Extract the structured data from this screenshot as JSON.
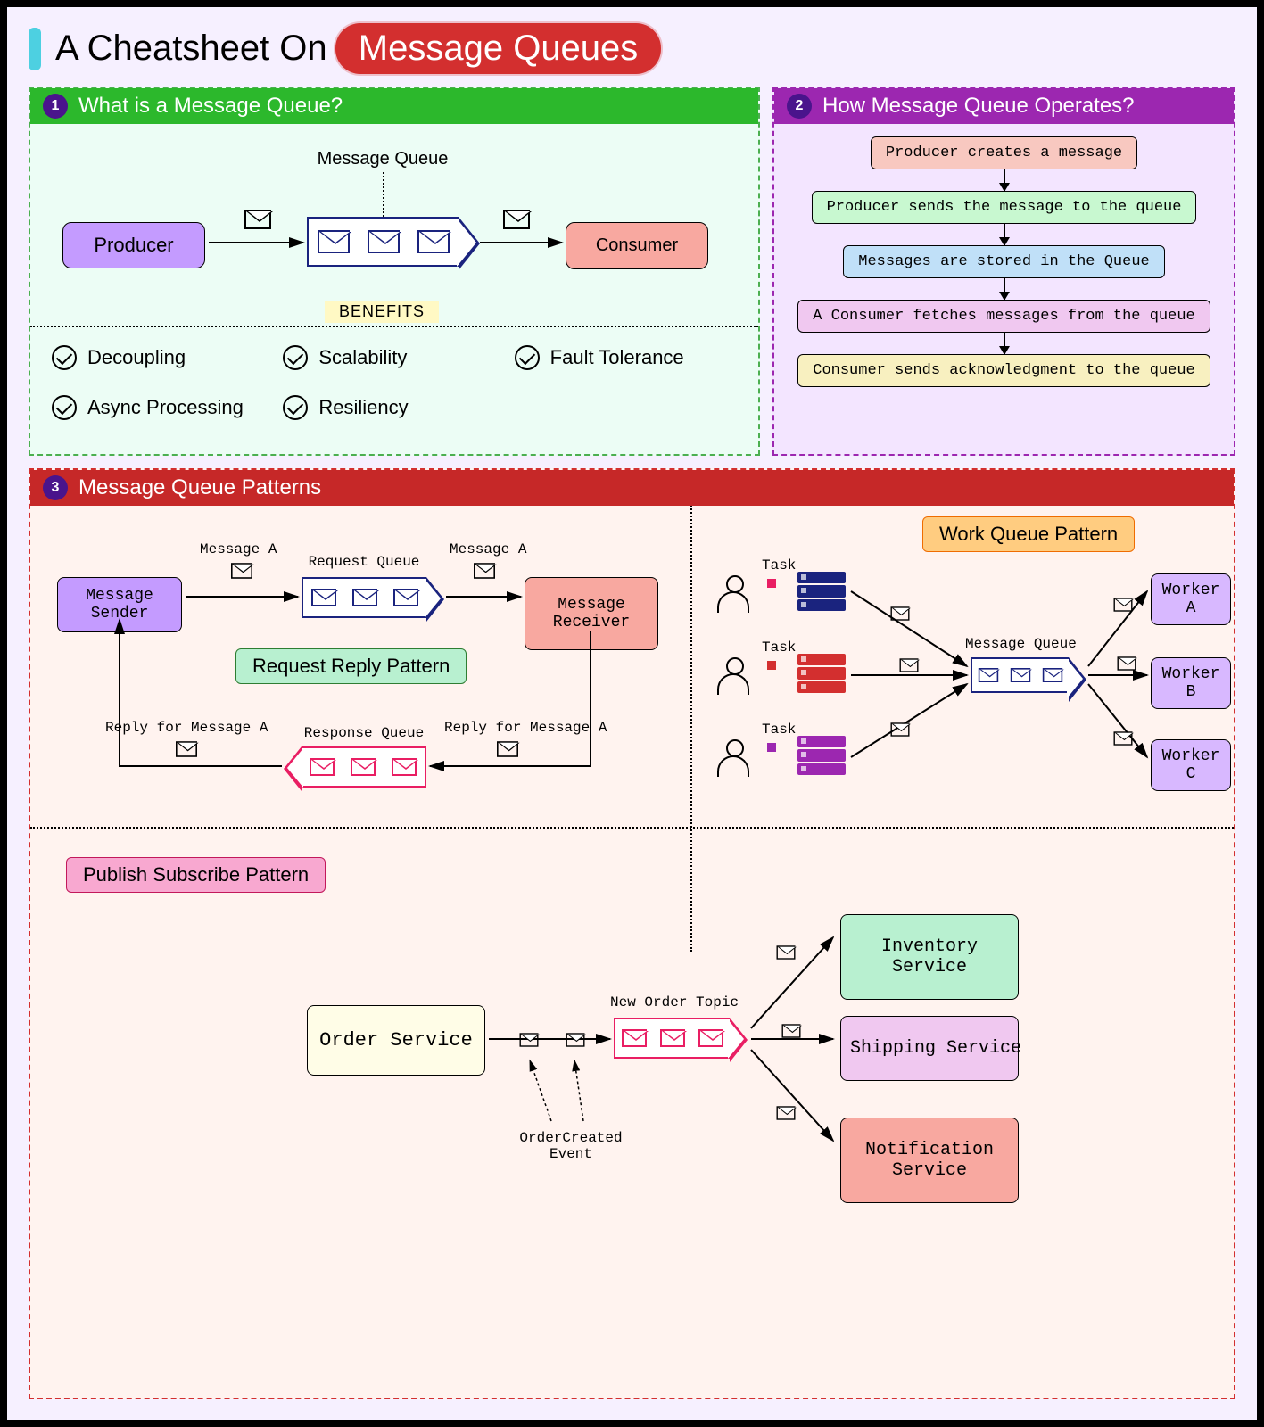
{
  "title": {
    "prefix": "A Cheatsheet On",
    "highlight": "Message Queues"
  },
  "panel1": {
    "num": "1",
    "header": "What is a Message Queue?",
    "producer": "Producer",
    "consumer": "Consumer",
    "queue_label": "Message Queue",
    "benefits_heading": "BENEFITS",
    "benefits": [
      "Decoupling",
      "Scalability",
      "Fault Tolerance",
      "Async Processing",
      "Resiliency"
    ]
  },
  "panel2": {
    "num": "2",
    "header": "How Message Queue Operates?",
    "steps": [
      {
        "text": "Producer creates a message",
        "color": "#f8c8c0"
      },
      {
        "text": "Producer sends the message to the queue",
        "color": "#c8f8d0"
      },
      {
        "text": "Messages are stored in the Queue",
        "color": "#c0e0f8"
      },
      {
        "text": "A Consumer fetches messages from the queue",
        "color": "#f0c8f0"
      },
      {
        "text": "Consumer sends acknowledgment to the queue",
        "color": "#f8f0c0"
      }
    ]
  },
  "panel3": {
    "num": "3",
    "header": "Message Queue Patterns",
    "request_reply": {
      "label": "Request Reply Pattern",
      "sender": "Message Sender",
      "receiver": "Message Receiver",
      "req_queue": "Request Queue",
      "res_queue": "Response Queue",
      "msg_a": "Message A",
      "reply_a": "Reply for Message A"
    },
    "work_queue": {
      "label": "Work Queue Pattern",
      "task": "Task",
      "mq": "Message Queue",
      "workers": [
        "Worker A",
        "Worker B",
        "Worker C"
      ]
    },
    "pubsub": {
      "label": "Publish Subscribe Pattern",
      "publisher": "Order Service",
      "topic": "New Order Topic",
      "event": "OrderCreated\nEvent",
      "subscribers": [
        {
          "name": "Inventory\nService",
          "color": "#b8f0d0"
        },
        {
          "name": "Shipping Service",
          "color": "#f0c8f0"
        },
        {
          "name": "Notification\nService",
          "color": "#f8a8a0"
        }
      ]
    }
  }
}
